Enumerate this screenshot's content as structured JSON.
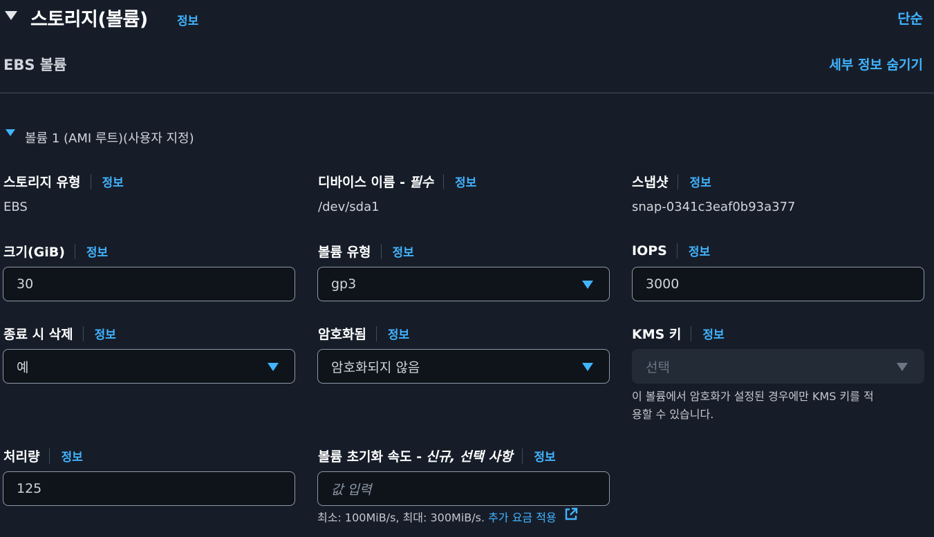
{
  "header": {
    "title": "스토리지(볼륨)",
    "info": "정보",
    "simple_link": "단순"
  },
  "ebs": {
    "title": "EBS 볼륨",
    "hide_details": "세부 정보 숨기기"
  },
  "volume": {
    "title": "볼륨 1 (AMI 루트)(사용자 지정)",
    "storage_type": {
      "label": "스토리지 유형",
      "info": "정보",
      "value": "EBS"
    },
    "device_name": {
      "label": "디바이스 이름 -",
      "required": "필수",
      "info": "정보",
      "value": "/dev/sda1"
    },
    "snapshot": {
      "label": "스냅샷",
      "info": "정보",
      "value": "snap-0341c3eaf0b93a377"
    },
    "size": {
      "label": "크기(GiB)",
      "info": "정보",
      "value": "30"
    },
    "volume_type": {
      "label": "볼륨 유형",
      "info": "정보",
      "value": "gp3"
    },
    "iops": {
      "label": "IOPS",
      "info": "정보",
      "value": "3000"
    },
    "delete_on_termination": {
      "label": "종료 시 삭제",
      "info": "정보",
      "value": "예"
    },
    "encrypted": {
      "label": "암호화됨",
      "info": "정보",
      "value": "암호화되지 않음"
    },
    "kms_key": {
      "label": "KMS 키",
      "info": "정보",
      "value": "선택",
      "hint_line1": "이 볼륨에서 암호화가 설정된 경우에만 KMS 키를 적",
      "hint_line2": "용할 수 있습니다."
    },
    "throughput": {
      "label": "처리량",
      "info": "정보",
      "value": "125"
    },
    "init_rate": {
      "label": "볼륨 초기화 속도 -",
      "required": "신규, 선택 사항",
      "info": "정보",
      "placeholder": "값 입력",
      "hint": "최소: 100MiB/s, 최대: 300MiB/s.",
      "hint_link": "추가 요금 적용"
    }
  },
  "colors": {
    "background": "#161d29",
    "accent": "#42b4ff",
    "input_border": "#8d99a8"
  },
  "icons": [
    "caret-down-icon",
    "dropdown-arrow-icon",
    "external-link-icon"
  ]
}
